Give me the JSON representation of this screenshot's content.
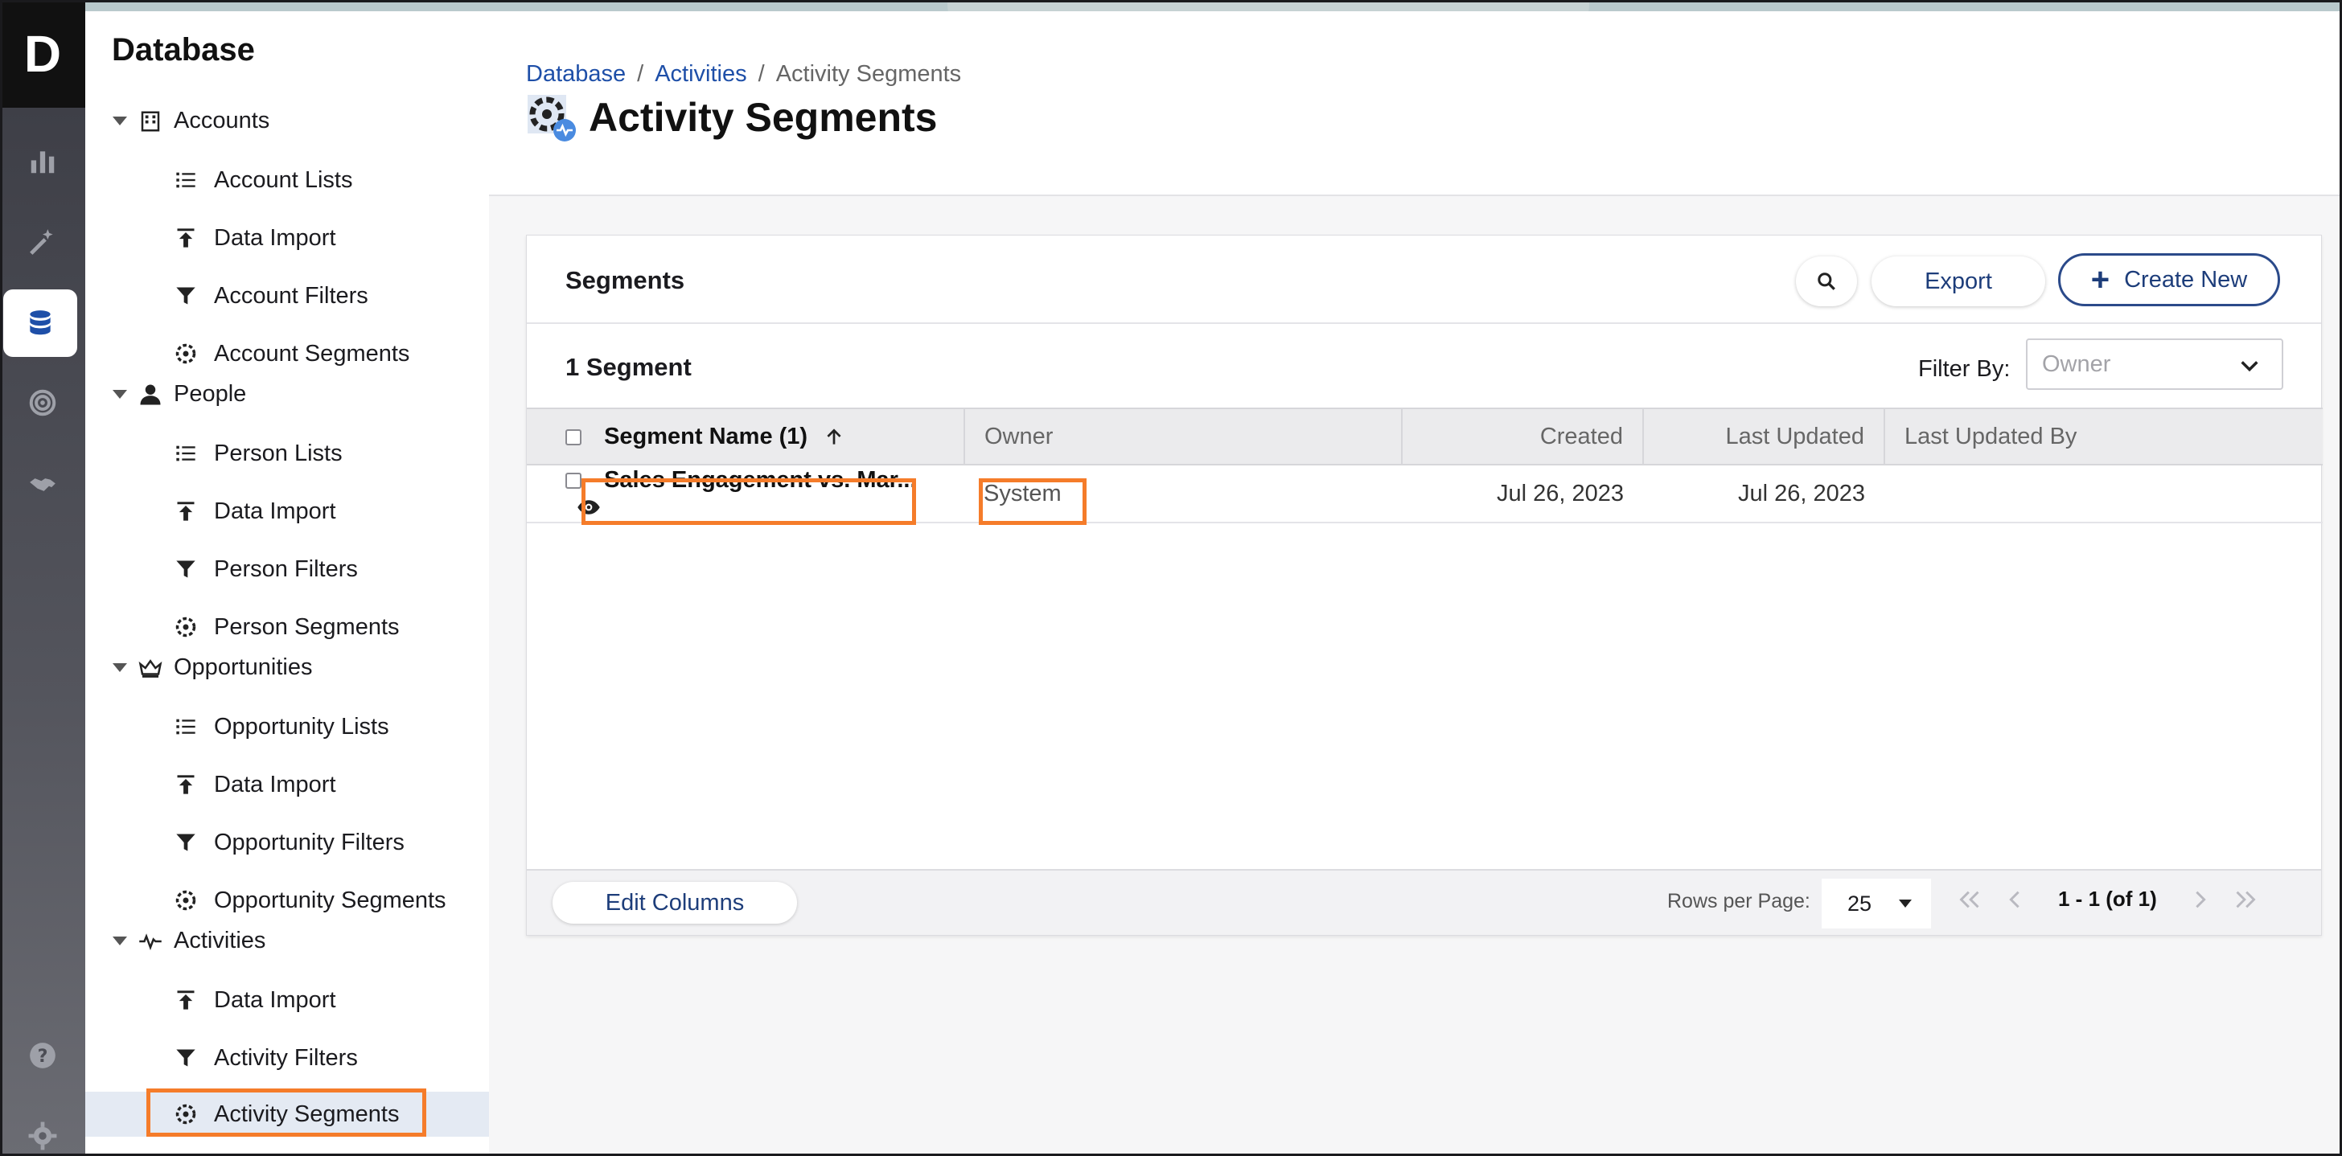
{
  "app": {
    "logo_letter": "D"
  },
  "rail": {
    "items": [
      {
        "name": "analytics-icon"
      },
      {
        "name": "magic-wand-icon"
      },
      {
        "name": "database-icon",
        "active": true
      },
      {
        "name": "target-icon"
      },
      {
        "name": "handshake-icon"
      }
    ],
    "bottom": [
      {
        "name": "help-icon"
      },
      {
        "name": "settings-icon"
      }
    ]
  },
  "sidebar": {
    "title": "Database",
    "groups": {
      "accounts": {
        "label": "Accounts",
        "items": [
          "Account Lists",
          "Data Import",
          "Account Filters",
          "Account Segments"
        ]
      },
      "people": {
        "label": "People",
        "items": [
          "Person Lists",
          "Data Import",
          "Person Filters",
          "Person Segments"
        ]
      },
      "opportunities": {
        "label": "Opportunities",
        "items": [
          "Opportunity Lists",
          "Data Import",
          "Opportunity Filters",
          "Opportunity Segments"
        ]
      },
      "activities": {
        "label": "Activities",
        "items": [
          "Data Import",
          "Activity Filters",
          "Activity Segments"
        ]
      }
    },
    "highlight_color": "#f57c2a"
  },
  "breadcrumb": {
    "items": [
      "Database",
      "Activities",
      "Activity Segments"
    ],
    "separator": "/"
  },
  "page": {
    "title": "Activity Segments"
  },
  "card": {
    "title": "Segments",
    "export_label": "Export",
    "create_label": "Create New",
    "count_label": "1 Segment",
    "filter": {
      "label": "Filter By:",
      "placeholder": "Owner"
    }
  },
  "table": {
    "columns": [
      "Segment Name (1)",
      "Owner",
      "Created",
      "Last Updated",
      "Last Updated By"
    ],
    "rows": [
      {
        "name": "Sales Engagement vs. Mar...",
        "owner": "System",
        "created": "Jul 26, 2023",
        "updated": "Jul 26, 2023",
        "updated_by": ""
      }
    ]
  },
  "footer": {
    "edit_columns": "Edit Columns",
    "rows_per_page_label": "Rows per Page:",
    "rows_per_page": "25",
    "range": "1 - 1 (of 1)"
  },
  "colors": {
    "accent": "#1d3d7a",
    "link": "#1e4fa8",
    "highlight": "#f57c2a"
  }
}
